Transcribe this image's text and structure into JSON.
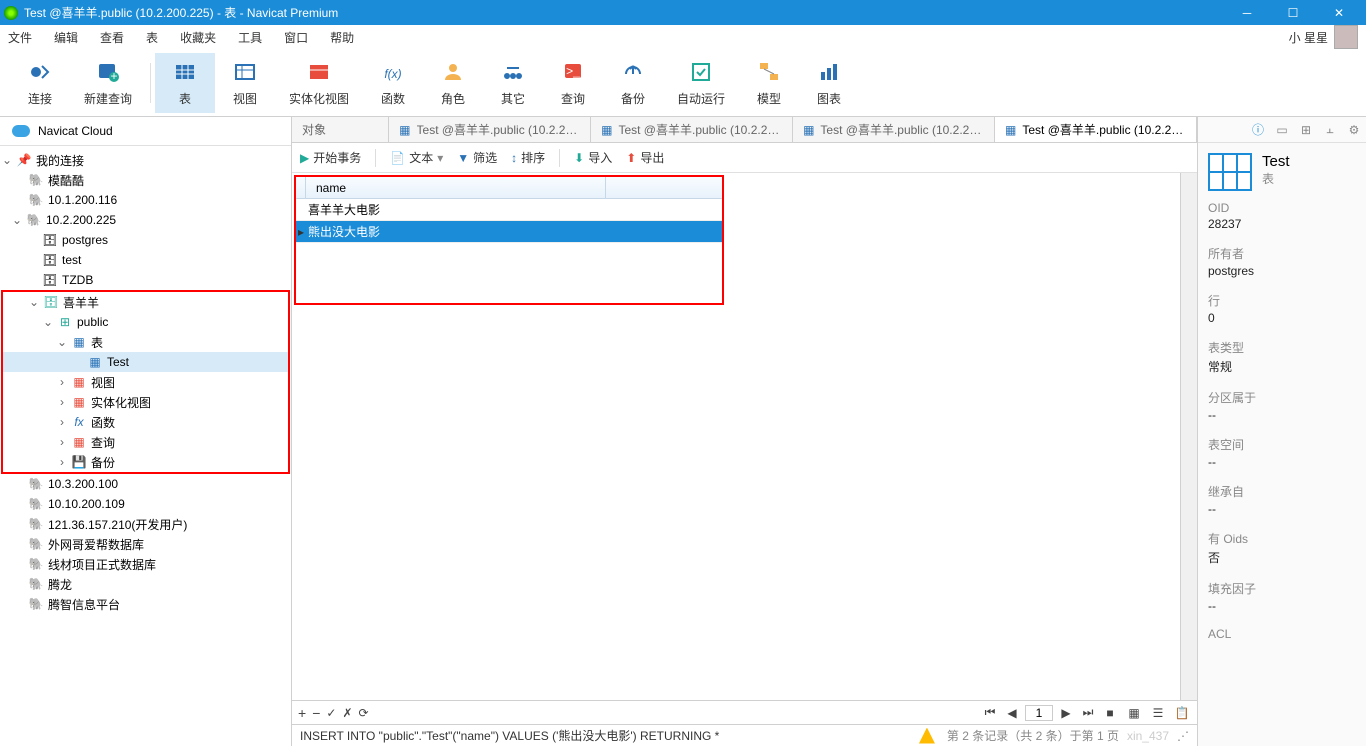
{
  "title": "Test @喜羊羊.public (10.2.200.225) - 表 - Navicat Premium",
  "menu": [
    "文件",
    "编辑",
    "查看",
    "表",
    "收藏夹",
    "工具",
    "窗口",
    "帮助"
  ],
  "user": "小 星星",
  "toolbar": [
    {
      "l": "连接"
    },
    {
      "l": "新建查询"
    },
    {
      "l": "表",
      "active": true
    },
    {
      "l": "视图"
    },
    {
      "l": "实体化视图"
    },
    {
      "l": "函数"
    },
    {
      "l": "角色"
    },
    {
      "l": "其它"
    },
    {
      "l": "查询"
    },
    {
      "l": "备份"
    },
    {
      "l": "自动运行"
    },
    {
      "l": "模型"
    },
    {
      "l": "图表"
    }
  ],
  "cloud": "Navicat Cloud",
  "tree_root": "我的连接",
  "tree": {
    "n1": "模酷酷",
    "n2": "10.1.200.116",
    "n3": "10.2.200.225",
    "d1": "postgres",
    "d2": "test",
    "d3": "TZDB",
    "d4": "喜羊羊",
    "s1": "public",
    "t1": "表",
    "t2": "Test",
    "t3": "视图",
    "t4": "实体化视图",
    "t5": "函数",
    "t6": "查询",
    "t7": "备份",
    "n4": "10.3.200.100",
    "n5": "10.10.200.109",
    "n6": "121.36.157.210(开发用户)",
    "n7": "外网哥爱帮数据库",
    "n8": "线材项目正式数据库",
    "n9": "腾龙",
    "n10": "腾智信息平台"
  },
  "tabs": [
    {
      "l": "对象"
    },
    {
      "l": "Test @喜羊羊.public (10.2.20..."
    },
    {
      "l": "Test @喜羊羊.public (10.2.20..."
    },
    {
      "l": "Test @喜羊羊.public (10.2.20..."
    },
    {
      "l": "Test @喜羊羊.public (10.2.20...",
      "active": true
    }
  ],
  "subbar": {
    "begin": "开始事务",
    "text": "文本",
    "filter": "筛选",
    "sort": "排序",
    "import": "导入",
    "export": "导出"
  },
  "grid": {
    "col": "name",
    "rows": [
      "喜羊羊大电影",
      "熊出没大电影"
    ],
    "sel": 1
  },
  "bottom": {
    "page": "1",
    "status": "第 2 条记录（共 2 条）于第 1 页",
    "wm": "xin_437"
  },
  "sql": "INSERT INTO \"public\".\"Test\"(\"name\") VALUES ('熊出没大电影') RETURNING *",
  "info": {
    "title": "Test",
    "sub": "表",
    "props": [
      {
        "l": "OID",
        "v": "28237"
      },
      {
        "l": "所有者",
        "v": "postgres"
      },
      {
        "l": "行",
        "v": "0"
      },
      {
        "l": "表类型",
        "v": "常规"
      },
      {
        "l": "分区属于",
        "v": "--"
      },
      {
        "l": "表空间",
        "v": "--"
      },
      {
        "l": "继承自",
        "v": "--"
      },
      {
        "l": "有 Oids",
        "v": "否"
      },
      {
        "l": "填充因子",
        "v": "--"
      },
      {
        "l": "ACL",
        "v": ""
      }
    ]
  }
}
